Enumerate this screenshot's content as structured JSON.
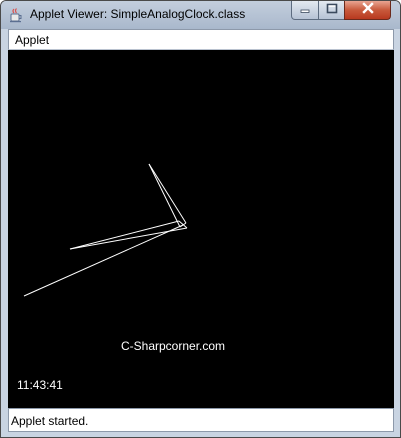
{
  "window": {
    "title": "Applet Viewer: SimpleAnalogClock.class",
    "app_icon": "java-cup-icon",
    "controls": {
      "minimize_icon": "minimize-icon",
      "maximize_icon": "maximize-icon",
      "close_icon": "close-icon"
    }
  },
  "menubar": {
    "items": [
      {
        "label": "Applet"
      }
    ]
  },
  "applet": {
    "brand_text": "C-Sharpcorner.com",
    "time_text": "11:43:41",
    "background": "#000000",
    "hand_color": "#ffffff"
  },
  "statusbar": {
    "text": "Applet started."
  }
}
